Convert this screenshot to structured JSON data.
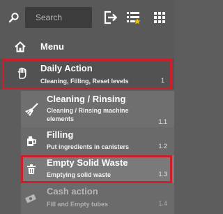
{
  "toolbar": {
    "search_placeholder": "Search",
    "search_icon": "search-icon",
    "logout_icon": "logout-icon",
    "list_icon": "list-star-icon",
    "grid_icon": "grid-icon"
  },
  "menu": {
    "label": "Menu",
    "icon": "home-icon"
  },
  "items": [
    {
      "title": "Daily Action",
      "subtitle": "Cleaning, Filling, Reset levels",
      "number": "1",
      "icon": "hand-icon",
      "highlighted": true
    },
    {
      "title": "Cleaning / Rinsing",
      "subtitle_line1": "Cleaning / Rinsing machine",
      "subtitle_line2": "elements",
      "number": "1.1",
      "icon": "broom-icon"
    },
    {
      "title": "Filling",
      "subtitle": "Put ingredients in canisters",
      "number": "1.2",
      "icon": "canister-icon"
    },
    {
      "title": "Empty Solid Waste",
      "subtitle": "Emptying solid waste",
      "number": "1.3",
      "icon": "trash-icon",
      "highlighted": true
    },
    {
      "title": "Cash action",
      "subtitle": "Fill and Empty tubes",
      "number": "1.4",
      "icon": "cash-icon",
      "disabled": true
    }
  ],
  "colors": {
    "highlight": "#cc1f2b",
    "background": "#5d5d5d"
  }
}
